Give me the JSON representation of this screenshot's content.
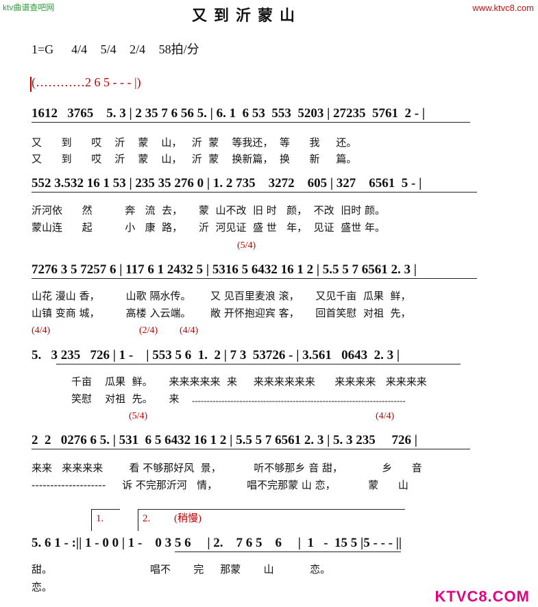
{
  "watermark": {
    "left": "ktv曲谱查吧网",
    "right": "www.ktvc8.com",
    "logo": "KTVC8.COM"
  },
  "title": "又到沂蒙山",
  "meta": "1=G    4/4   5/4   2/4   58拍/分",
  "intro": "(…………2 6 5 - - - |)",
  "section1": {
    "notes": "1612   3765    5. 3 | 2 35 7 6 56 5. | 6. 1  6 53  553  5203 | 27235  5761  2 - |",
    "lyrics1": "又      到      哎    沂    蒙    山，   沂  蒙    等我还，  等      我     还。",
    "lyrics2": "又      到      哎    沂    蒙    山，   沂  蒙    换新篇，  换      新     篇。"
  },
  "section2": {
    "notes": "552 3.532 16 1 53 | 235 35 276 0 | 1. 2 735    3272    605 | 327    6561  5 - |",
    "lyrics1": "沂河依      然          奔   流  去，     蒙  山不改  旧 时   颜，  不改  旧时 颜。",
    "lyrics2": "蒙山连      起          小   康  路，     沂  河见证  盛 世   年，  见证  盛世 年。"
  },
  "section3": {
    "marker": "(5/4)",
    "notes": "7276 3 5 7257 6 | 117 6 1 2432 5 | 5316 5 6432 16 1 2 | 5.5 5 7 6561 2. 3 |",
    "lyrics1": "山花 漫山 香，        山歌 隔水传。      又 见百里麦浪 滚，     又见千亩  瓜果  鲜，",
    "lyrics2": "山镇 变商 城，        高楼 入云端。      敞 开怀抱迎宾 客，     回首笑慰  对祖  先，"
  },
  "section4": {
    "marker1": "(4/4)",
    "marker2": "(2/4)",
    "marker3": "(4/4)",
    "notes": "5.   3 235   726 | 1 -    | 553 5 6  1.  2 | 7 3  53726 - | 3.561   0643  2. 3 |",
    "lyrics1": "千亩    瓜果  鲜。     来来来来来  来     来来来来来来      来来来来   来来来来",
    "lyrics2": "笑慰    对祖  先。     来",
    "dashes": "------------------------------------------------------------------------"
  },
  "section5": {
    "marker1": "(5/4)",
    "marker2": "(4/4)",
    "notes": "2  2   0276 6 5. | 531  6 5 6432 16 1 2 | 5.5 5 7 6561 2. 3 | 5. 3 235     726 |",
    "lyrics1": "来来   来来来来        看 不够那好风  景，          听不够那乡 音 甜，            乡      音",
    "lyrics2": "--------------------     诉 不完那沂河   情，         唱不完那蒙 山 恋，          蒙      山"
  },
  "section6": {
    "ending1": "1.",
    "ending2": "2.",
    "ending2_note": "(稍慢)",
    "notes": "5. 6 1 - :|| 1 - 0 0 | 1 -    0 3 5 6     | 2.    7 6 5    6     |  1   -  15 5 |5 - - - ||",
    "lyrics1": "甜。                              唱不       完     那蒙       山           恋。",
    "lyrics2": "恋。"
  }
}
